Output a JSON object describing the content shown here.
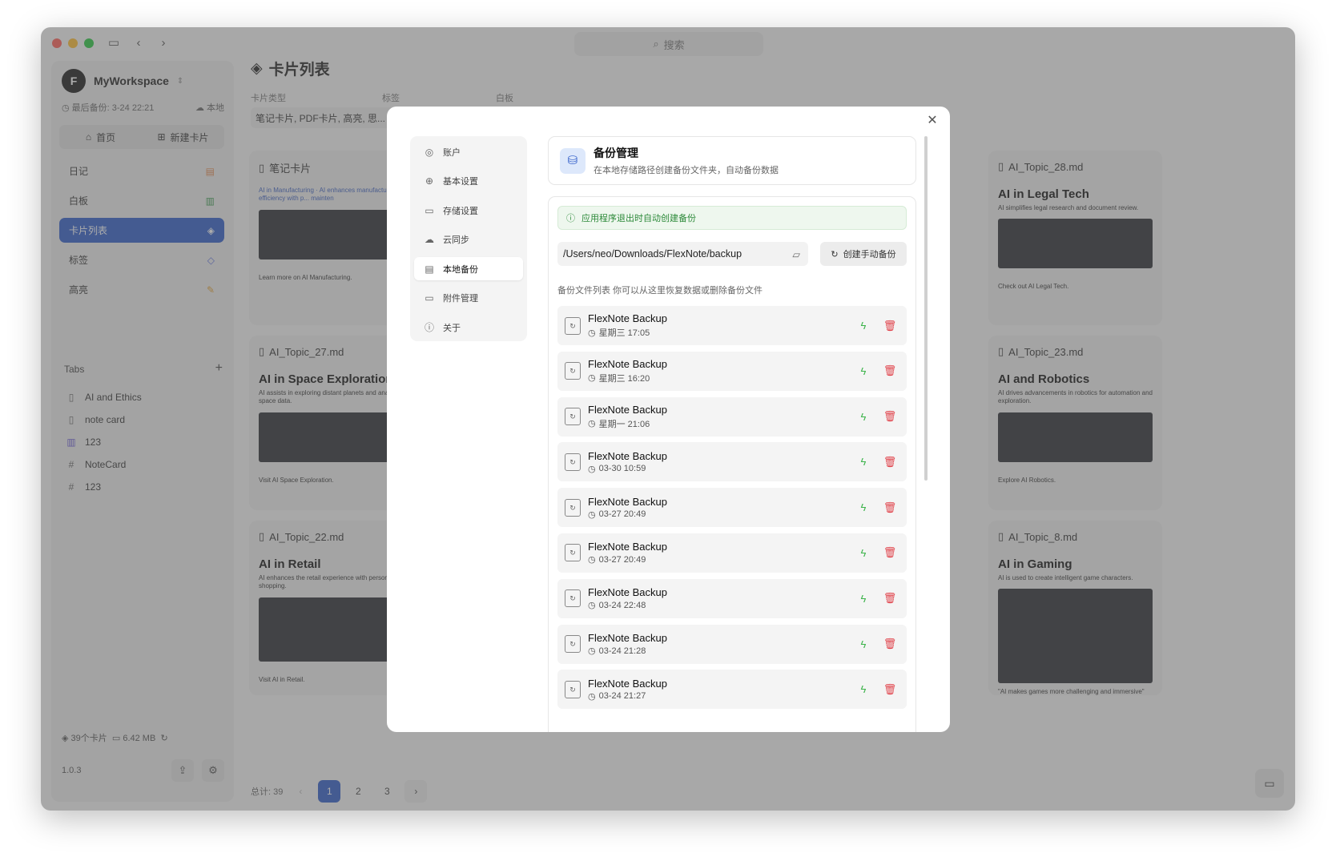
{
  "titlebar": {
    "search_placeholder": "搜索"
  },
  "workspace": {
    "name": "MyWorkspace",
    "last_backup": "最后备份: 3-24 22:21",
    "location": "本地"
  },
  "quick_actions": {
    "home": "首页",
    "new_card": "新建卡片"
  },
  "nav": [
    {
      "label": "日记",
      "icon": "journal-icon",
      "color": "#e5894f"
    },
    {
      "label": "白板",
      "icon": "map-icon",
      "color": "#3e9b50"
    },
    {
      "label": "卡片列表",
      "icon": "layers-icon",
      "active": true
    },
    {
      "label": "标签",
      "icon": "tag-icon",
      "color": "#5a6fe0"
    },
    {
      "label": "高亮",
      "icon": "highlighter-icon",
      "color": "#e3a130"
    }
  ],
  "tabs": {
    "heading": "Tabs",
    "items": [
      {
        "label": "AI and Ethics",
        "icon": "file-icon"
      },
      {
        "label": "note card",
        "icon": "file-icon"
      },
      {
        "label": "123",
        "icon": "map-icon"
      },
      {
        "label": "NoteCard",
        "icon": "hash-icon"
      },
      {
        "label": "123",
        "icon": "hash-icon"
      }
    ]
  },
  "footer": {
    "cards": "39个卡片",
    "size": "6.42 MB",
    "version": "1.0.3"
  },
  "main": {
    "title": "卡片列表",
    "filter_type": "卡片类型",
    "filter_tag": "标签",
    "filter_board": "白板",
    "filter_value": "笔记卡片, PDF卡片, 高亮, 思..."
  },
  "cards": [
    {
      "file": "笔记卡片",
      "heading": "",
      "text": "AI in Manufacturing · AI enhances manufacturing efficiency with p... mainten",
      "link": "Learn more on AI Manufacturing."
    },
    {
      "file": "AI_Topic_27.md",
      "heading": "AI in Space Exploration",
      "text": "AI assists in exploring distant planets and anal... space data.",
      "link": "Visit AI Space Exploration."
    },
    {
      "file": "AI_Topic_22.md",
      "heading": "AI in Retail",
      "text": "AI enhances the retail experience with person... shopping.",
      "link": "Visit AI in Retail."
    },
    {
      "file": "AI_Topic_28.md",
      "heading": "AI in Legal Tech",
      "text": "AI simplifies legal research and document review.",
      "link": "Check out AI Legal Tech."
    },
    {
      "file": "AI_Topic_23.md",
      "heading": "AI and Robotics",
      "text": "AI drives advancements in robotics for automation and exploration.",
      "link": "Explore AI Robotics."
    },
    {
      "file": "AI_Topic_8.md",
      "heading": "AI in Gaming",
      "text": "AI is used to create intelligent game characters.",
      "link": "\"AI makes games more challenging and immersive\""
    }
  ],
  "pager": {
    "total": "总计: 39",
    "pages": [
      "1",
      "2",
      "3"
    ]
  },
  "settings_modal": {
    "nav": [
      {
        "label": "账户",
        "icon": "user-icon"
      },
      {
        "label": "基本设置",
        "icon": "globe-icon"
      },
      {
        "label": "存储设置",
        "icon": "folder-icon"
      },
      {
        "label": "云同步",
        "icon": "cloud-icon"
      },
      {
        "label": "本地备份",
        "icon": "archive-icon",
        "active": true
      },
      {
        "label": "附件管理",
        "icon": "folder-icon"
      },
      {
        "label": "关于",
        "icon": "info-icon"
      }
    ],
    "header_title": "备份管理",
    "header_desc": "在本地存储路径创建备份文件夹，自动备份数据",
    "notice": "应用程序退出时自动创建备份",
    "backup_path": "/Users/neo/Downloads/FlexNote/backup",
    "manual_backup": "创建手动备份",
    "list_hint": "备份文件列表 你可以从这里恢复数据或删除备份文件",
    "accent": "#2f5cc8",
    "restore_color": "#3cb34a",
    "delete_color": "#e0424a",
    "backups": [
      {
        "name": "FlexNote Backup",
        "time": "星期三 17:05"
      },
      {
        "name": "FlexNote Backup",
        "time": "星期三 16:20"
      },
      {
        "name": "FlexNote Backup",
        "time": "星期一 21:06"
      },
      {
        "name": "FlexNote Backup",
        "time": "03-30 10:59"
      },
      {
        "name": "FlexNote Backup",
        "time": "03-27 20:49"
      },
      {
        "name": "FlexNote Backup",
        "time": "03-27 20:49"
      },
      {
        "name": "FlexNote Backup",
        "time": "03-24 22:48"
      },
      {
        "name": "FlexNote Backup",
        "time": "03-24 21:28"
      },
      {
        "name": "FlexNote Backup",
        "time": "03-24 21:27"
      }
    ]
  }
}
